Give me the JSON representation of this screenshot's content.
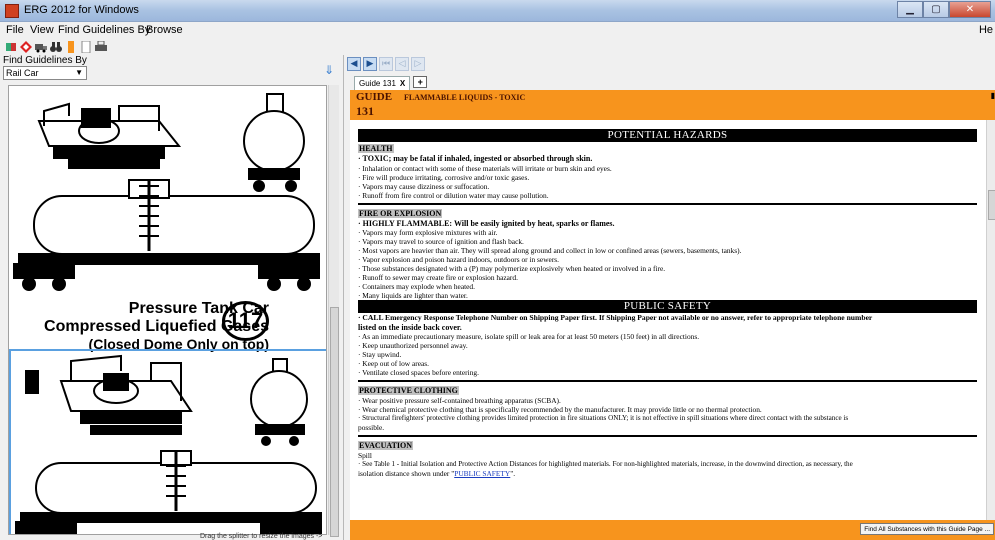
{
  "window": {
    "title": "ERG 2012 for Windows"
  },
  "menu": {
    "items": [
      "File",
      "View",
      "Find Guidelines By",
      "Browse"
    ],
    "help": "He"
  },
  "toolbar": {
    "icons": [
      "book-icon",
      "placard-icon",
      "truck-icon",
      "binoculars-icon",
      "bookmark-icon",
      "page-icon",
      "print-icon"
    ]
  },
  "left_panel": {
    "label": "Find Guidelines By",
    "selected": "Rail Car",
    "caption_line1": "Pressure Tank Car",
    "caption_line2": "Compressed Liquefied Gases",
    "caption_line3": "(Closed Dome Only on top)",
    "guide_number": "117",
    "splitter_hint": "Drag the splitter to resize the images ->"
  },
  "tabs": [
    {
      "label": "Guide 131",
      "close": "X"
    }
  ],
  "tab_add": "+",
  "guide": {
    "label": "GUIDE",
    "title": "FLAMMABLE LIQUIDS - TOXIC",
    "number": "131"
  },
  "content": {
    "potential_hazards": "POTENTIAL HAZARDS",
    "health_title": "HEALTH",
    "health_bold": "· TOXIC; may be fatal if inhaled, ingested or absorbed through skin.",
    "health_lines": [
      "· Inhalation or contact with some of these materials will irritate or burn skin and eyes.",
      "· Fire will produce irritating, corrosive and/or toxic gases.",
      "· Vapors may cause dizziness or suffocation.",
      "· Runoff from fire control or dilution water may cause pollution."
    ],
    "fire_title": "FIRE OR EXPLOSION",
    "fire_bold": "· HIGHLY FLAMMABLE: Will be easily ignited by heat, sparks or flames.",
    "fire_lines": [
      "· Vapors may form explosive mixtures with air.",
      "· Vapors may travel to source of ignition and flash back.",
      "· Most vapors are heavier than air. They will spread along ground and collect in low or confined areas (sewers, basements, tanks).",
      "· Vapor explosion and poison hazard indoors, outdoors or in sewers.",
      "· Those substances designated with a (P) may polymerize explosively when heated or involved in a fire.",
      "· Runoff to sewer may create fire or explosion hazard.",
      "· Containers may explode when heated.",
      "· Many liquids are lighter than water."
    ],
    "public_safety": "PUBLIC SAFETY",
    "ps_bold_1": "· CALL Emergency Response Telephone Number on Shipping Paper first. If Shipping Paper not available or no answer, refer to appropriate telephone number",
    "ps_bold_2": "listed on the inside back cover.",
    "ps_lines": [
      "· As an immediate precautionary measure, isolate spill or leak area for at least 50 meters (150 feet) in all directions.",
      "· Keep unauthorized personnel away.",
      "· Stay upwind.",
      "· Keep out of low areas.",
      "· Ventilate closed spaces before entering."
    ],
    "pc_title": "PROTECTIVE CLOTHING",
    "pc_lines": [
      "· Wear positive pressure self-contained breathing apparatus (SCBA).",
      "· Wear chemical protective clothing that is specifically recommended by the manufacturer. It may provide little or no thermal protection.",
      "· Structural firefighters' protective clothing provides limited protection in fire situations ONLY; it is not effective in spill situations where direct contact with the substance is",
      "possible."
    ],
    "evac_title": "EVACUATION",
    "evac_spill": "Spill",
    "evac_line1": "· See Table 1 - Initial Isolation and Protective Action Distances for highlighted materials. For non-highlighted materials, increase, in the downwind direction, as necessary, the",
    "evac_line2_prefix": "isolation distance shown under \"",
    "evac_link": "PUBLIC SAFETY",
    "evac_line2_suffix": "\"."
  },
  "find_all_button": "Find All Substances with this Guide Page ..."
}
